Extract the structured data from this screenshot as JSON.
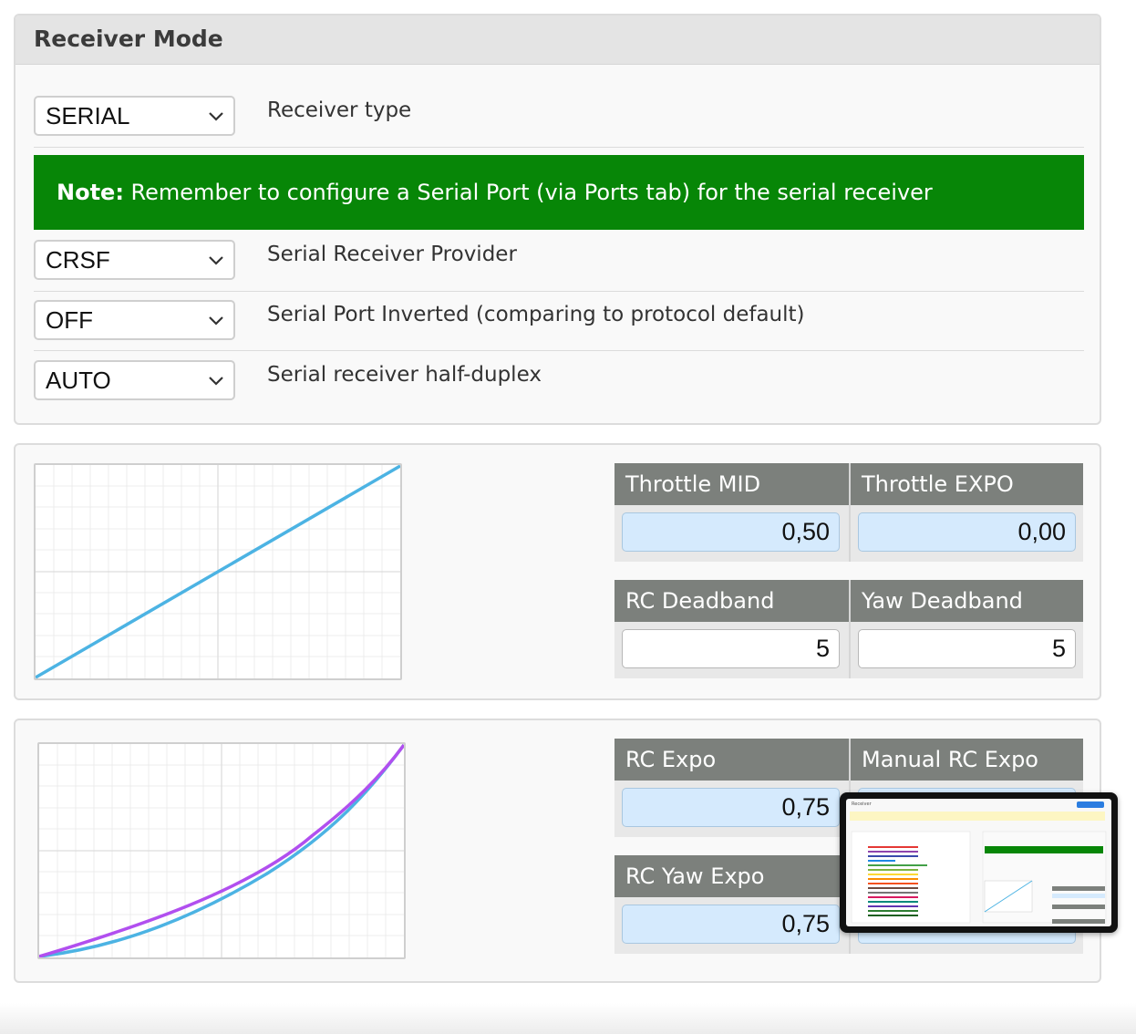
{
  "receiver_mode": {
    "title": "Receiver Mode",
    "receiver_type": {
      "value": "SERIAL",
      "label": "Receiver type"
    },
    "note": {
      "prefix": "Note:",
      "text": " Remember to configure a Serial Port (via Ports tab) for the serial receiver"
    },
    "provider": {
      "value": "CRSF",
      "label": "Serial Receiver Provider"
    },
    "inverted": {
      "value": "OFF",
      "label": "Serial Port Inverted (comparing to protocol default)"
    },
    "half_duplex": {
      "value": "AUTO",
      "label": "Serial receiver half-duplex"
    }
  },
  "throttle": {
    "mid_label": "Throttle MID",
    "mid_value": "0,50",
    "expo_label": "Throttle EXPO",
    "expo_value": "0,00",
    "rc_deadband_label": "RC Deadband",
    "rc_deadband_value": "5",
    "yaw_deadband_label": "Yaw Deadband",
    "yaw_deadband_value": "5"
  },
  "rates": {
    "rc_expo_label": "RC Expo",
    "rc_expo_value": "0,75",
    "manual_rc_expo_label": "Manual RC Expo",
    "rc_yaw_expo_label": "RC Yaw Expo",
    "rc_yaw_expo_value": "0,75"
  },
  "colors": {
    "note_bg": "#078607",
    "header_cell": "#7c807c",
    "input_blue": "#d5eafd",
    "curve_blue": "#4cb3e3",
    "curve_purple": "#b14fef"
  },
  "thumbnail": {
    "title": "Receiver"
  }
}
